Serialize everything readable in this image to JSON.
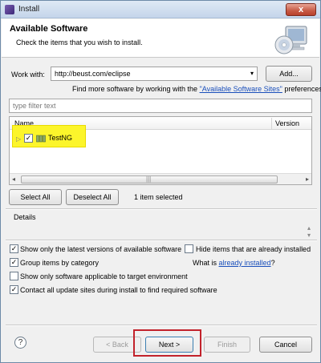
{
  "window": {
    "title": "Install",
    "close_label": "x"
  },
  "header": {
    "title": "Available Software",
    "subtitle": "Check the items that you wish to install."
  },
  "work_with": {
    "label": "Work with:",
    "value": "http://beust.com/eclipse",
    "add_button": "Add...",
    "find_more_prefix": "Find more software by working with the ",
    "find_more_link": "\"Available Software Sites\"",
    "find_more_suffix": " preferences."
  },
  "filter": {
    "placeholder": "type filter text"
  },
  "tree": {
    "columns": [
      "Name",
      "Version"
    ],
    "items": [
      {
        "label": "TestNG",
        "checked": true,
        "expand": "▷",
        "check_glyph": "✓"
      }
    ],
    "highlight_color": "#fcf52b",
    "scroll_left": "◂",
    "scroll_right": "▸",
    "scroll_grip": "|||"
  },
  "selection": {
    "select_all": "Select All",
    "deselect_all": "Deselect All",
    "status": "1 item selected"
  },
  "details": {
    "label": "Details",
    "spinner_up": "▴",
    "spinner_down": "▾"
  },
  "options": {
    "latest_versions": {
      "label": "Show only the latest versions of available software",
      "checked": true
    },
    "group_by_category": {
      "label": "Group items by category",
      "checked": true
    },
    "applicable_only": {
      "label": "Show only software applicable to target environment",
      "checked": false
    },
    "contact_sites": {
      "label": "Contact all update sites during install to find required software",
      "checked": true
    },
    "hide_installed": {
      "label": "Hide items that are already installed",
      "checked": false
    },
    "what_is_prefix": "What is ",
    "what_is_link": "already installed",
    "what_is_suffix": "?"
  },
  "footer": {
    "help_glyph": "?",
    "back": "< Back",
    "next": "Next >",
    "finish": "Finish",
    "cancel": "Cancel",
    "next_highlight_color": "#c2222b"
  },
  "icons": {
    "combo_arrow": "▾"
  }
}
